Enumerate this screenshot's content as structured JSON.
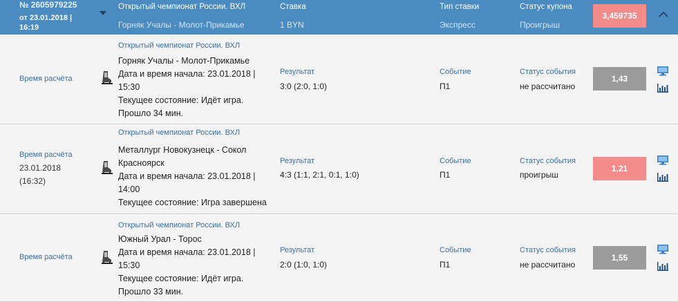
{
  "coupon": {
    "number": "№ 2605979225",
    "date_line1": "от 23.01.2018 |",
    "date_line2": "16:19",
    "championship_label": "Открытый чемпионат России. ВХЛ",
    "match": "Горняк Учалы - Молот-Прикамье",
    "stake_label": "Ставка",
    "stake_value": "1 BYN",
    "bet_type_label": "Тип ставки",
    "bet_type_value": "Экспресс",
    "status_label": "Статус купона",
    "status_value": "Проигрыш",
    "coefficient": "3,459735",
    "colors": {
      "header_bg": "#4a8bc2",
      "lost": "#f48b8b",
      "pending": "#9b9b9b",
      "link": "#3b6fa5"
    }
  },
  "events": [
    {
      "time_label": "Время расчёта",
      "time_value_line1": "",
      "time_value_line2": "",
      "championship": "Открытый чемпионат России. ВХЛ",
      "lines": [
        "Горняк Учалы - Молот-Прикамье",
        "Дата и время начала: 23.01.2018 |",
        "15:30",
        "Текущее состояние: Идёт игра.",
        "Прошло 34 мин."
      ],
      "result_label": "Результат",
      "result_value": "3:0 (2:0, 1:0)",
      "event_label": "Событие",
      "event_value": "П1",
      "event_status_label": "Статус события",
      "event_status_value": "не рассчитано",
      "coefficient": "1,43",
      "icon": "skate-icon"
    },
    {
      "time_label": "Время расчёта",
      "time_value_line1": "23.01.2018",
      "time_value_line2": "(16:32)",
      "championship": "Открытый чемпионат России. ВХЛ",
      "lines": [
        "Металлург Новокузнецк - Сокол",
        "Красноярск",
        "Дата и время начала: 23.01.2018 |",
        "14:00",
        "Текущее состояние: Игра завершена"
      ],
      "result_label": "Результат",
      "result_value": "4:3 (1:1, 2:1, 0:1, 1:0)",
      "event_label": "Событие",
      "event_value": "П1",
      "event_status_label": "Статус события",
      "event_status_value": "проигрыш",
      "coefficient": "1,21",
      "icon": "skate-icon"
    },
    {
      "time_label": "Время расчёта",
      "time_value_line1": "",
      "time_value_line2": "",
      "championship": "Открытый чемпионат России. ВХЛ",
      "lines": [
        "Южный Урал - Торос",
        "Дата и время начала: 23.01.2018 |",
        "15:30",
        "Текущее состояние: Идёт игра.",
        "Прошло 33 мин."
      ],
      "result_label": "Результат",
      "result_value": "2:0 (1:0, 1:0)",
      "event_label": "Событие",
      "event_value": "П1",
      "event_status_label": "Статус события",
      "event_status_value": "не рассчитано",
      "coefficient": "1,55",
      "icon": "skate-icon"
    }
  ]
}
